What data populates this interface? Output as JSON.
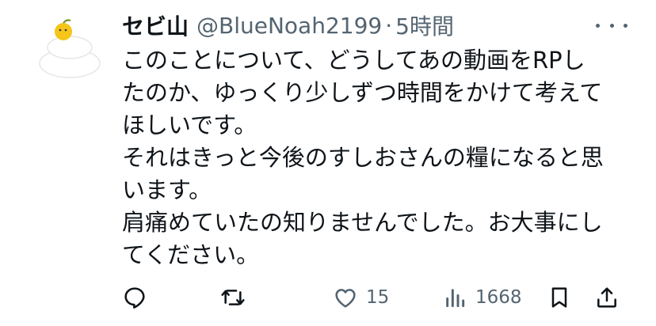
{
  "tweet": {
    "author": {
      "display_name": "セビ山",
      "handle": "@BlueNoah2199",
      "avatar_icon": "kagami-mochi-avatar"
    },
    "separator": "·",
    "timestamp": "5時間",
    "more_icon": "more-horizontal-icon",
    "text_lines": [
      "このことについて、どうしてあの動画をRPし",
      "たのか、ゆっくり少しずつ時間をかけて考えて",
      "ほしいです。",
      "それはきっと今後のすしおさんの糧になると思",
      "います。",
      "肩痛めていたの知りませんでした。お大事にし",
      "てください。"
    ],
    "actions": {
      "reply": {
        "icon": "reply-icon",
        "count": ""
      },
      "retweet": {
        "icon": "retweet-icon",
        "count": ""
      },
      "like": {
        "icon": "heart-icon",
        "count": "15"
      },
      "views": {
        "icon": "views-chart-icon",
        "count": "1668"
      },
      "bookmark": {
        "icon": "bookmark-icon"
      },
      "share": {
        "icon": "share-icon"
      }
    },
    "colors": {
      "text": "#0f1419",
      "secondary": "#536471",
      "avatar_accent": "#f5c518"
    }
  }
}
